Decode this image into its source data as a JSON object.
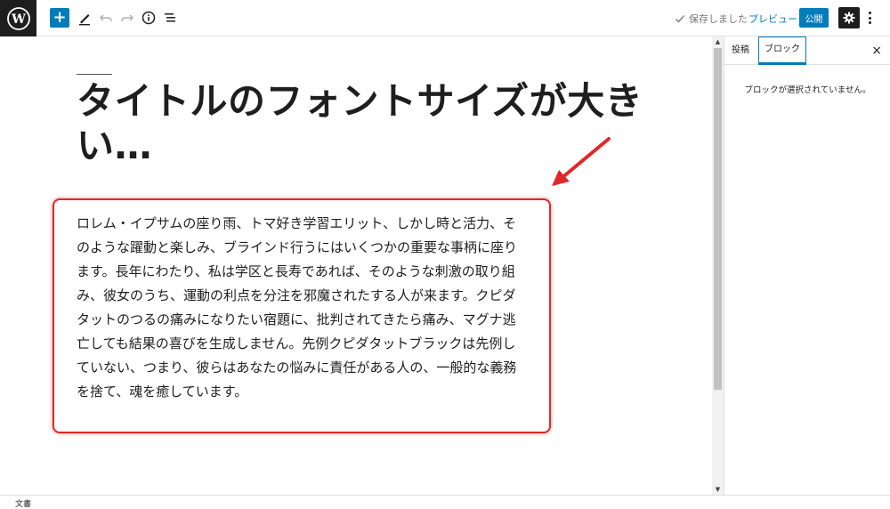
{
  "toolbar": {
    "add_label": "+",
    "saved_label": "保存しました",
    "preview_label": "プレビュー",
    "publish_label": "公開"
  },
  "post": {
    "title": "タイトルのフォントサイズが大きい…",
    "paragraph": "ロレム・イプサムの座り雨、トマ好き学習エリット、しかし時と活力、そのような躍動と楽しみ、ブラインド行うにはいくつかの重要な事柄に座ります。長年にわたり、私は学区と長寿であれば、そのような刺激の取り組み、彼女のうち、運動の利点を分注を邪魔されたする人が来ます。クピダタットのつるの痛みになりたい宿題に、批判されてきたら痛み、マグナ逃亡しても結果の喜びを生成しません。先例クピダタットブラックは先例していない、つまり、彼らはあなたの悩みに責任がある人の、一般的な義務を捨て、魂を癒しています。"
  },
  "sidebar": {
    "tabs": [
      {
        "label": "投稿"
      },
      {
        "label": "ブロック"
      }
    ],
    "close_label": "×",
    "empty_message": "ブロックが選択されていません。"
  },
  "footer": {
    "breadcrumb": "文書"
  },
  "colors": {
    "accent": "#007cba",
    "highlight": "#e02828",
    "dark": "#1e1e1e"
  },
  "icons": [
    "wordpress-logo-icon",
    "plus-icon",
    "pencil-icon",
    "undo-icon",
    "redo-icon",
    "info-icon",
    "list-view-icon",
    "check-icon",
    "gear-icon",
    "more-vertical-icon",
    "close-icon"
  ]
}
